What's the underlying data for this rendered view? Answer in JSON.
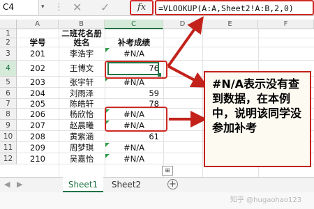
{
  "toolbar": {
    "namebox": "C4",
    "namebox_arrow": "▾",
    "more_icon": "⋮",
    "cancel_icon": "✕",
    "enter_icon": "✓",
    "fx_label": "fx",
    "formula": "=VLOOKUP(A:A,Sheet2!A:B,2,0)"
  },
  "columns": [
    "A",
    "B",
    "C",
    "D",
    "E",
    "F"
  ],
  "rows": [
    {
      "num": "1",
      "a": "",
      "b": "二班花名册",
      "c": ""
    },
    {
      "num": "2",
      "a": "学号",
      "b": "姓名",
      "c": "补考成绩"
    },
    {
      "num": "3",
      "a": "201",
      "b": "李浩宇",
      "c": "#N/A"
    },
    {
      "num": "4",
      "a": "202",
      "b": "王博文",
      "c": "76"
    },
    {
      "num": "5",
      "a": "203",
      "b": "张宇轩",
      "c": "#N/A"
    },
    {
      "num": "6",
      "a": "204",
      "b": "刘雨泽",
      "c": "59"
    },
    {
      "num": "7",
      "a": "205",
      "b": "陈皓轩",
      "c": "78"
    },
    {
      "num": "8",
      "a": "206",
      "b": "杨欣怡",
      "c": "#N/A"
    },
    {
      "num": "9",
      "a": "207",
      "b": "赵晨曦",
      "c": "#N/A"
    },
    {
      "num": "10",
      "a": "208",
      "b": "黄紫涵",
      "c": "61"
    },
    {
      "num": "11",
      "a": "209",
      "b": "周梦琪",
      "c": "#N/A"
    },
    {
      "num": "12",
      "a": "210",
      "b": "吴嘉怡",
      "c": "#N/A"
    }
  ],
  "annotation": {
    "text": "#N/A表示没有查到数据，在本例中，说明该同学没参加补考"
  },
  "sheets": {
    "tab1": "Sheet1",
    "tab2": "Sheet2",
    "add": "+"
  },
  "watermark": "知乎 @hugaohao123",
  "quick_analysis": "⊞",
  "colors": {
    "accent": "#217346",
    "annotation_red": "#c2221a",
    "error_triangle": "#2e9b48"
  }
}
